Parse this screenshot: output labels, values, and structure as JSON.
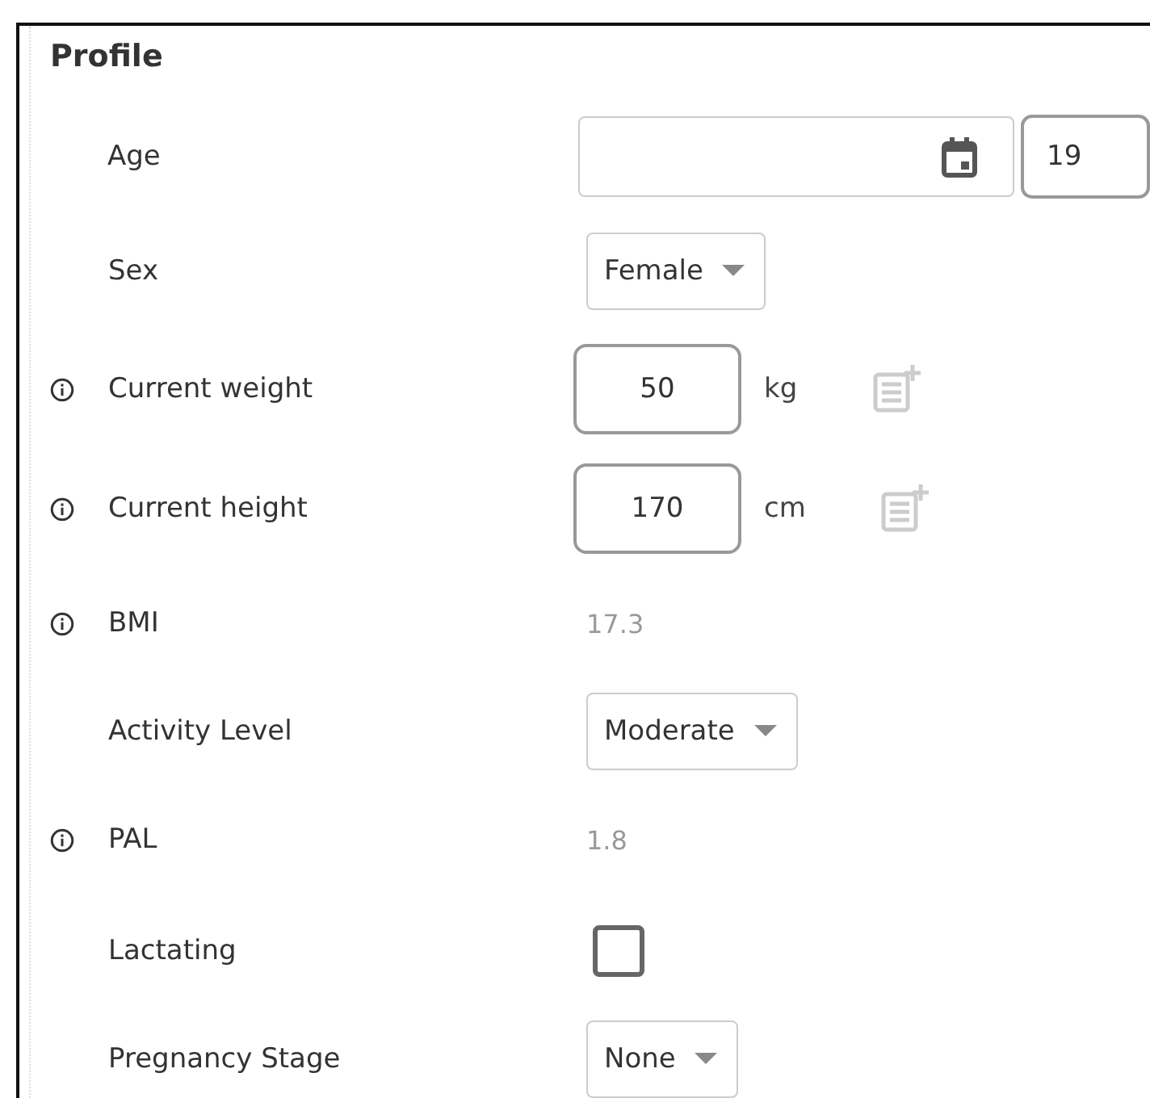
{
  "panel": {
    "title": "Profile"
  },
  "fields": [
    {
      "kind": "date",
      "label": "Age",
      "info": false,
      "age": "19"
    },
    {
      "kind": "select",
      "label": "Sex",
      "info": false,
      "value": "Female"
    },
    {
      "kind": "number",
      "label": "Current weight",
      "info": true,
      "value": "50",
      "unit": "kg"
    },
    {
      "kind": "number",
      "label": "Current height",
      "info": true,
      "value": "170",
      "unit": "cm"
    },
    {
      "kind": "readonly",
      "label": "BMI",
      "info": true,
      "value": "17.3"
    },
    {
      "kind": "select",
      "label": "Activity Level",
      "info": false,
      "value": "Moderate"
    },
    {
      "kind": "readonly",
      "label": "PAL",
      "info": true,
      "value": "1.8"
    },
    {
      "kind": "checkbox",
      "label": "Lactating",
      "info": false,
      "checked": false
    },
    {
      "kind": "select",
      "label": "Pregnancy Stage",
      "info": false,
      "value": "None"
    }
  ]
}
